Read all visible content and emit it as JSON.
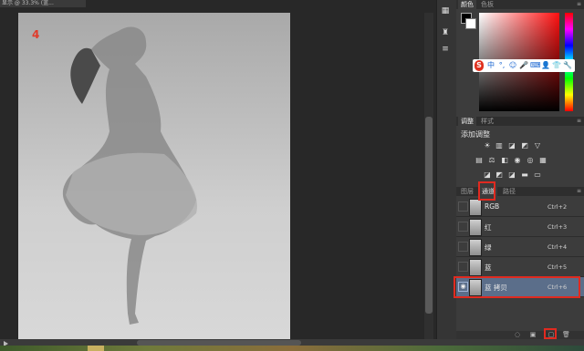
{
  "document": {
    "tab_label": "显示 @ 33.3% (蓝..."
  },
  "canvas": {
    "step_marker": "4"
  },
  "color_panel": {
    "tabs": [
      "颜色",
      "色板"
    ],
    "active_tab": 0
  },
  "ime_toolbar": {
    "items": [
      "S",
      "中",
      "°,",
      "☺",
      "🎤",
      "⌨",
      "👤",
      "👕",
      "🔧"
    ]
  },
  "adjustments_panel": {
    "tabs": [
      "调整",
      "样式"
    ],
    "title": "添加调整"
  },
  "channels_panel": {
    "tabs": [
      "图层",
      "通道",
      "路径"
    ],
    "active_tab": 1,
    "channels": [
      {
        "name": "RGB",
        "shortcut": "Ctrl+2",
        "visible": false,
        "selected": false
      },
      {
        "name": "红",
        "shortcut": "Ctrl+3",
        "visible": false,
        "selected": false
      },
      {
        "name": "绿",
        "shortcut": "Ctrl+4",
        "visible": false,
        "selected": false
      },
      {
        "name": "蓝",
        "shortcut": "Ctrl+5",
        "visible": false,
        "selected": false
      },
      {
        "name": "蓝 拷贝",
        "shortcut": "Ctrl+6",
        "visible": true,
        "selected": true
      }
    ]
  },
  "colors": {
    "highlight": "#e02a20",
    "selected_row": "#5b6e8a",
    "panel_bg": "#3c3c3c"
  }
}
